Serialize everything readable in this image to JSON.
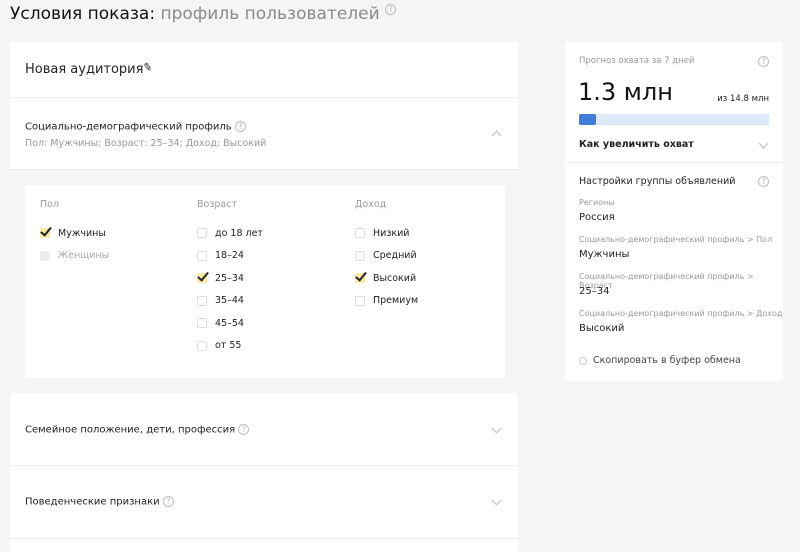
{
  "header": {
    "title": "Условия показа:",
    "subtitle": "профиль пользователей",
    "help": "?"
  },
  "audience": {
    "name": "Новая аудитория"
  },
  "socdem": {
    "title": "Социально-демографический профиль",
    "summary": "Пол: Мужчины; Возраст: 25–34; Доход: Высокий",
    "columns": [
      {
        "header": "Пол",
        "options": [
          {
            "label": "Мужчины",
            "state": "checked"
          },
          {
            "label": "Женщины",
            "state": "disabled"
          }
        ]
      },
      {
        "header": "Возраст",
        "options": [
          {
            "label": "до 18 лет",
            "state": "unchecked"
          },
          {
            "label": "18–24",
            "state": "unchecked"
          },
          {
            "label": "25–34",
            "state": "checked"
          },
          {
            "label": "35–44",
            "state": "unchecked"
          },
          {
            "label": "45–54",
            "state": "unchecked"
          },
          {
            "label": "от 55",
            "state": "unchecked"
          }
        ]
      },
      {
        "header": "Доход",
        "options": [
          {
            "label": "Низкий",
            "state": "unchecked"
          },
          {
            "label": "Средний",
            "state": "unchecked"
          },
          {
            "label": "Высокий",
            "state": "checked"
          },
          {
            "label": "Премиум",
            "state": "unchecked"
          }
        ]
      }
    ]
  },
  "sections": [
    {
      "title": "Семейное положение, дети, профессия"
    },
    {
      "title": "Поведенческие признаки"
    }
  ],
  "forecast": {
    "label": "Прогноз охвата за 7 дней",
    "value": "1.3 млн",
    "total": "из 14.8 млн",
    "progress": 0.088,
    "increase": "Как увеличить охват",
    "bar_color": "#3f7fd9",
    "track_color": "#dde9f8"
  },
  "settings": {
    "title": "Настройки группы объявлений",
    "items": [
      {
        "label": "Регионы",
        "value": "Россия"
      },
      {
        "label": "Социально-демографический профиль > Пол",
        "value": "Мужчины"
      },
      {
        "label": "Социально-демографический профиль > Возраст",
        "value": "25–34"
      },
      {
        "label": "Социально-демографический профиль > Доход",
        "value": "Высокий"
      }
    ],
    "copy": "Скопировать в буфер обмена"
  }
}
